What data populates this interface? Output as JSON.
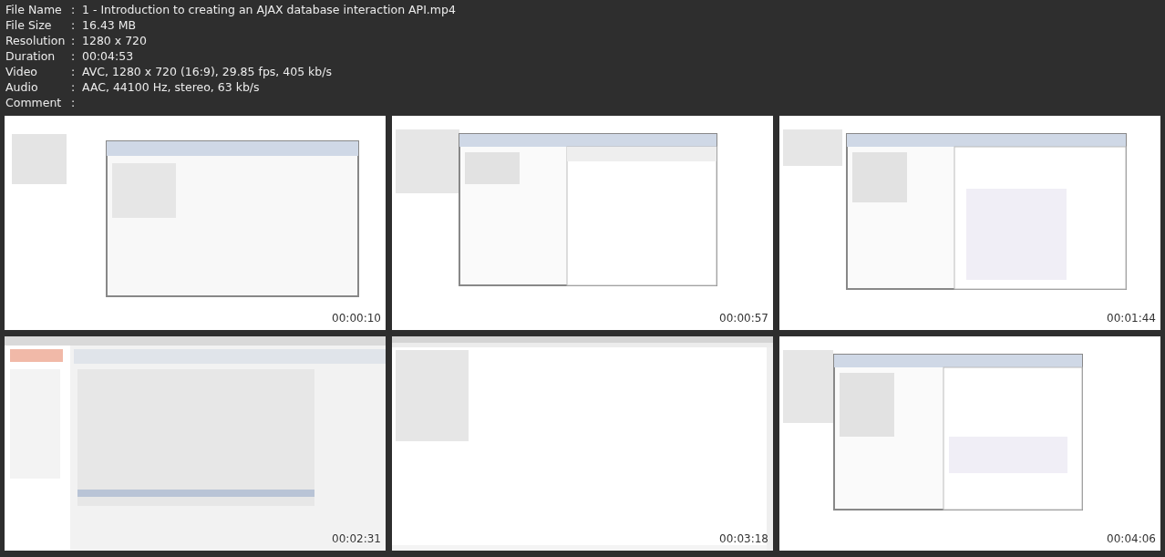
{
  "info": [
    {
      "label": "File Name",
      "separator": ":",
      "value": "1 - Introduction to creating an AJAX database interaction API.mp4"
    },
    {
      "label": "File Size",
      "separator": ":",
      "value": "16.43 MB"
    },
    {
      "label": "Resolution",
      "separator": ":",
      "value": "1280 x 720"
    },
    {
      "label": "Duration",
      "separator": ":",
      "value": "00:04:53"
    },
    {
      "label": "Video",
      "separator": ":",
      "value": "AVC, 1280 x 720 (16:9), 29.85 fps, 405 kb/s"
    },
    {
      "label": "Audio",
      "separator": ":",
      "value": "AAC, 44100 Hz, stereo, 63 kb/s"
    },
    {
      "label": "Comment",
      "separator": ":"
    }
  ],
  "thumbnails": [
    {
      "kind": "picture",
      "timestamp": "00:00:10"
    },
    {
      "kind": "picture",
      "timestamp": "00:00:57"
    },
    {
      "kind": "picture",
      "timestamp": "00:01:44"
    },
    {
      "kind": "picture",
      "timestamp": "00:02:31"
    },
    {
      "kind": "picture",
      "timestamp": "00:03:18"
    },
    {
      "kind": "picture",
      "timestamp": "00:04:06"
    }
  ]
}
